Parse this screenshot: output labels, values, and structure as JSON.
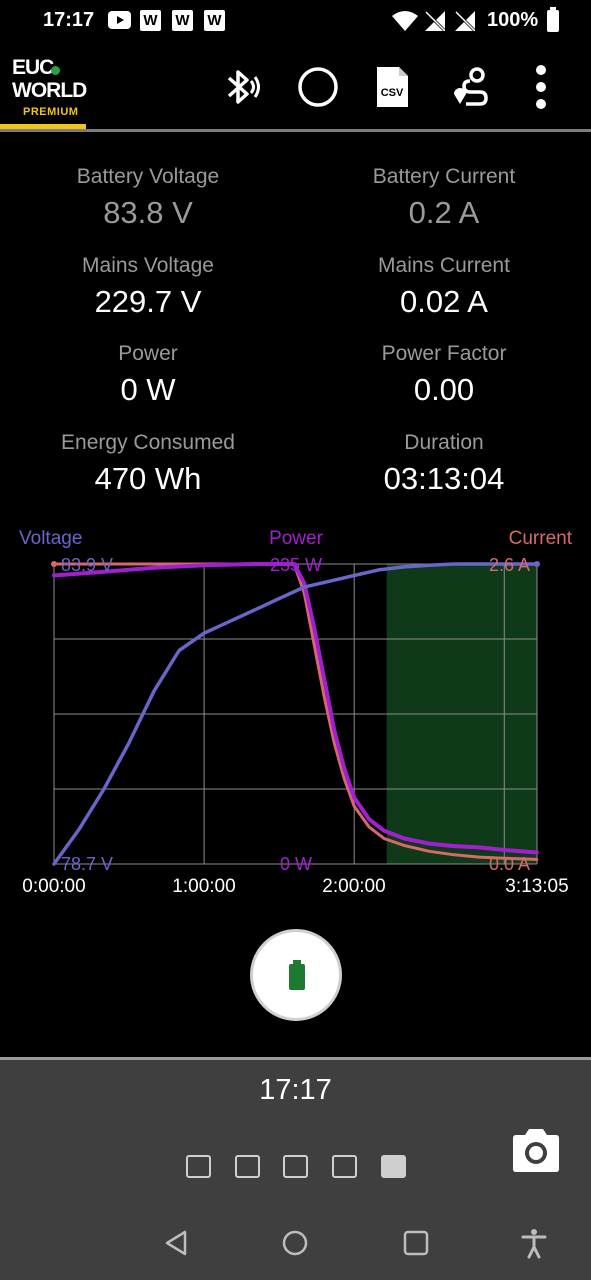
{
  "status": {
    "time": "17:17",
    "notif_w": "W",
    "battery_pct": "100%"
  },
  "app": {
    "logo_line1": "EUC",
    "logo_line2": "WORLD",
    "logo_tier": "PREMIUM"
  },
  "toolbar_icons": [
    "bluetooth-audio-icon",
    "record-circle-icon",
    "csv-export-icon",
    "route-icon",
    "overflow-menu-icon"
  ],
  "stats": [
    {
      "label": "Battery Voltage",
      "value": "83.8 V"
    },
    {
      "label": "Battery Current",
      "value": "0.2 A"
    },
    {
      "label": "Mains Voltage",
      "value": "229.7 V"
    },
    {
      "label": "Mains Current",
      "value": "0.02 A"
    },
    {
      "label": "Power",
      "value": "0 W"
    },
    {
      "label": "Power Factor",
      "value": "0.00"
    },
    {
      "label": "Energy Consumed",
      "value": "470 Wh"
    },
    {
      "label": "Duration",
      "value": "03:13:04"
    }
  ],
  "colors": {
    "voltage": "#6a66c9",
    "power": "#a020d0",
    "current": "#d66a6a",
    "charge_region": "#0f3a19",
    "accent": "#f0c419"
  },
  "chart_data": {
    "type": "line",
    "legend": [
      "Voltage",
      "Power",
      "Current"
    ],
    "x_labels": [
      "0:00:00",
      "1:00:00",
      "2:00:00",
      "3:13:05"
    ],
    "x_range_minutes": [
      0,
      193.08
    ],
    "series": [
      {
        "name": "Voltage",
        "unit": "V",
        "range": [
          78.7,
          83.9
        ],
        "max_label": "83.9 V",
        "min_label": "78.7 V",
        "x": [
          0,
          10,
          20,
          30,
          40,
          50,
          60,
          70,
          80,
          90,
          100,
          110,
          120,
          130,
          140,
          150,
          160,
          170,
          180,
          193
        ],
        "y": [
          78.7,
          79.3,
          80.0,
          80.8,
          81.7,
          82.4,
          82.7,
          82.9,
          83.1,
          83.3,
          83.5,
          83.6,
          83.7,
          83.8,
          83.85,
          83.88,
          83.9,
          83.9,
          83.9,
          83.9
        ]
      },
      {
        "name": "Power",
        "unit": "W",
        "range": [
          0,
          235
        ],
        "max_label": "235 W",
        "min_label": "0 W",
        "x": [
          0,
          20,
          40,
          60,
          80,
          90,
          96,
          100,
          104,
          108,
          112,
          116,
          120,
          126,
          132,
          140,
          150,
          160,
          170,
          180,
          193
        ],
        "y": [
          226,
          229,
          232,
          234,
          235,
          235,
          235,
          220,
          185,
          145,
          105,
          75,
          52,
          35,
          26,
          20,
          16,
          14,
          13,
          11,
          9
        ]
      },
      {
        "name": "Current",
        "unit": "A",
        "range": [
          0.0,
          2.6
        ],
        "max_label": "2.6 A",
        "min_label": "0.0 A",
        "x": [
          0,
          20,
          40,
          60,
          80,
          90,
          96,
          100,
          104,
          108,
          112,
          116,
          120,
          126,
          132,
          140,
          150,
          160,
          170,
          180,
          193
        ],
        "y": [
          2.6,
          2.6,
          2.6,
          2.6,
          2.6,
          2.6,
          2.6,
          2.35,
          1.9,
          1.45,
          1.05,
          0.74,
          0.5,
          0.32,
          0.22,
          0.16,
          0.11,
          0.08,
          0.06,
          0.05,
          0.04
        ]
      }
    ],
    "charging_region_minutes": [
      133,
      193.08
    ],
    "grid": true
  },
  "panel": {
    "clock": "17:17",
    "page_dots": 5,
    "active_dot": 4
  }
}
